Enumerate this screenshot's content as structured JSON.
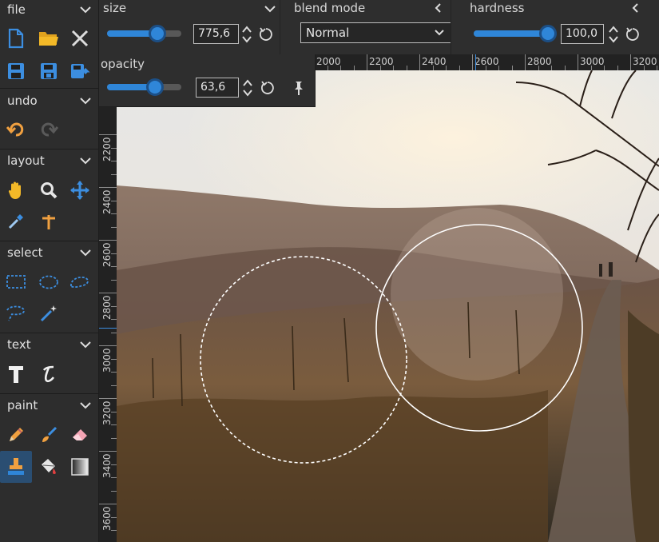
{
  "sections": {
    "file": {
      "label": "file"
    },
    "undo": {
      "label": "undo"
    },
    "layout": {
      "label": "layout"
    },
    "select": {
      "label": "select"
    },
    "text": {
      "label": "text"
    },
    "paint": {
      "label": "paint"
    }
  },
  "options": {
    "size": {
      "label": "size",
      "value": "775,6",
      "fraction": 0.68
    },
    "blend_mode": {
      "label": "blend mode",
      "selected": "Normal"
    },
    "hardness": {
      "label": "hardness",
      "value": "100,0",
      "fraction": 1.0
    },
    "opacity": {
      "label": "opacity",
      "value": "63,6",
      "fraction": 0.64
    }
  },
  "ruler": {
    "horizontal": [
      "2000",
      "2200",
      "2400",
      "2600",
      "2800",
      "3000",
      "3200"
    ],
    "vertical": [
      "2200",
      "2400",
      "2600",
      "2800",
      "3000",
      "3200",
      "3400",
      "3600"
    ]
  },
  "colors": {
    "accent": "#2f86d8",
    "panel": "#2d2d2d",
    "active_tool": "#2a4e72"
  },
  "icons": {
    "new": "new-file-icon",
    "open": "open-folder-icon",
    "close": "close-icon",
    "save": "save-icon",
    "save_as": "save-as-icon",
    "export": "export-icon",
    "undo": "undo-icon",
    "redo": "redo-icon",
    "hand": "hand-icon",
    "zoom": "magnifier-icon",
    "move": "move-icon",
    "eyedropper": "eyedropper-icon",
    "crop": "crop-icon",
    "rect_select": "rectangle-select-icon",
    "ellipse_select": "ellipse-select-icon",
    "lasso": "lasso-icon",
    "poly_lasso": "polygon-lasso-icon",
    "magic_wand": "magic-wand-icon",
    "text": "text-icon",
    "text_vertical": "text-italic-icon",
    "pencil": "pencil-icon",
    "brush": "brush-icon",
    "eraser": "eraser-icon",
    "clone_stamp": "clone-stamp-icon",
    "bucket": "paint-bucket-icon",
    "gradient": "gradient-icon"
  }
}
